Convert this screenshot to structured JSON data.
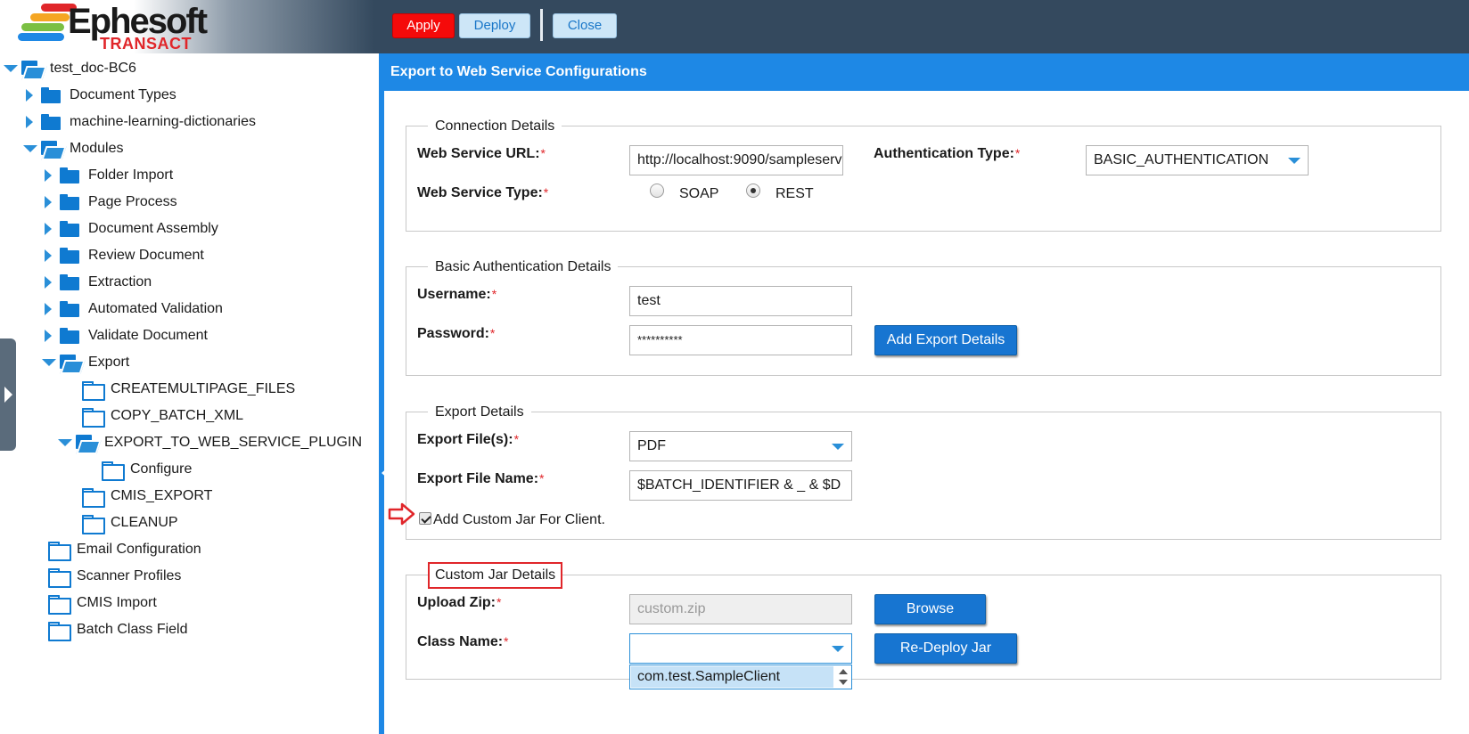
{
  "brand": {
    "name": "Ephesoft",
    "product": "TRANSACT",
    "stripe_colors": [
      "#e0262a",
      "#f5a623",
      "#7bc043",
      "#1e88e5"
    ]
  },
  "toolbar": {
    "apply_label": "Apply",
    "deploy_label": "Deploy",
    "close_label": "Close"
  },
  "tree": {
    "root": "test_doc-BC6",
    "document_types": "Document Types",
    "ml_dictionaries": "machine-learning-dictionaries",
    "modules": "Modules",
    "folder_import": "Folder Import",
    "page_process": "Page Process",
    "document_assembly": "Document Assembly",
    "review_document": "Review Document",
    "extraction": "Extraction",
    "automated_validation": "Automated Validation",
    "validate_document": "Validate Document",
    "export": "Export",
    "createmultipage_files": "CREATEMULTIPAGE_FILES",
    "copy_batch_xml": "COPY_BATCH_XML",
    "export_to_web_service_plugin": "EXPORT_TO_WEB_SERVICE_PLUGIN",
    "configure": "Configure",
    "cmis_export": "CMIS_EXPORT",
    "cleanup": "CLEANUP",
    "email_configuration": "Email Configuration",
    "scanner_profiles": "Scanner Profiles",
    "cmis_import": "CMIS Import",
    "batch_class_field": "Batch Class Field"
  },
  "main": {
    "title": "Export to Web Service Configurations",
    "connection": {
      "legend": "Connection Details",
      "url_label": "Web Service URL:",
      "url_value": "http://localhost:9090/sampleserv",
      "auth_type_label": "Authentication Type:",
      "auth_type_value": "BASIC_AUTHENTICATION",
      "service_type_label": "Web Service Type:",
      "soap_label": "SOAP",
      "rest_label": "REST",
      "selected_type": "REST"
    },
    "basic_auth": {
      "legend": "Basic Authentication Details",
      "username_label": "Username:",
      "username_value": "test",
      "password_label": "Password:",
      "password_value": "**********",
      "add_export_label": "Add Export Details"
    },
    "export_details": {
      "legend": "Export Details",
      "files_label": "Export File(s):",
      "files_value": "PDF",
      "file_name_label": "Export File Name:",
      "file_name_value": "$BATCH_IDENTIFIER & _ & $D",
      "custom_jar_label": "Add Custom Jar For Client.",
      "custom_jar_checked": true
    },
    "custom_jar": {
      "legend": "Custom Jar Details",
      "upload_label": "Upload Zip:",
      "upload_value": "custom.zip",
      "browse_label": "Browse",
      "class_name_label": "Class Name:",
      "class_name_value": "",
      "redeploy_label": "Re-Deploy Jar",
      "class_option": "com.test.SampleClient"
    },
    "required_marker": "*"
  }
}
